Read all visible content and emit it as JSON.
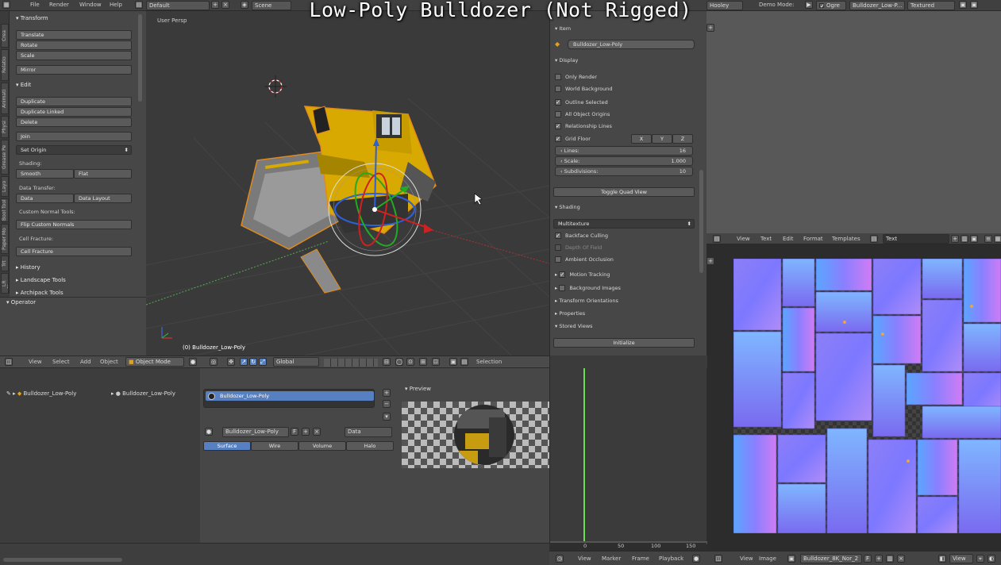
{
  "title_overlay": "Low-Poly Bulldozer (Not Rigged)",
  "topbar": {
    "menus": [
      "File",
      "Render",
      "Window",
      "Help"
    ],
    "layout": "Default",
    "scene": "Scene",
    "scene_name": "Hooley",
    "demo_mode": "Demo Mode:",
    "ogre": "Ogre",
    "object_field": "Bulldozer_Low-P...",
    "shading": "Textured"
  },
  "tabs": [
    "Crea",
    "Relatio",
    "Animati",
    "Physi",
    "Grease Pe",
    "Layo",
    "Bool Tool",
    "Paper Mo",
    "Trt",
    "LR Flare"
  ],
  "toolshelf": {
    "transform_header": "Transform",
    "translate": "Translate",
    "rotate": "Rotate",
    "scale": "Scale",
    "mirror": "Mirror",
    "edit_header": "Edit",
    "duplicate": "Duplicate",
    "duplicate_linked": "Duplicate Linked",
    "delete": "Delete",
    "join": "Join",
    "set_origin": "Set Origin",
    "shading_label": "Shading:",
    "smooth": "Smooth",
    "flat": "Flat",
    "data_transfer_label": "Data Transfer:",
    "data": "Data",
    "data_layout": "Data Layout",
    "custom_normals_label": "Custom Normal Tools:",
    "flip_normals": "Flip Custom Normals",
    "cell_fracture_label": "Cell Fracture:",
    "cell_fracture": "Cell Fracture",
    "history": "History",
    "landscape": "Landscape Tools",
    "archipack": "Archipack Tools",
    "operator": "Operator"
  },
  "viewport": {
    "label": "User Persp",
    "object_label": "(0) Bulldozer_Low-Poly"
  },
  "vp_header": {
    "view": "View",
    "select": "Select",
    "add": "Add",
    "object": "Object",
    "mode": "Object Mode",
    "orientation": "Global",
    "selection": "Selection"
  },
  "props": {
    "item_header": "Item",
    "object_name": "Bulldozer_Low-Poly",
    "display_header": "Display",
    "only_render": "Only Render",
    "world_background": "World Background",
    "outline_selected": "Outline Selected",
    "all_origins": "All Object Origins",
    "relationship_lines": "Relationship Lines",
    "grid_floor": "Grid Floor",
    "axis_x": "X",
    "axis_y": "Y",
    "axis_z": "Z",
    "lines_label": "Lines:",
    "lines_value": "16",
    "scale_label": "Scale:",
    "scale_value": "1.000",
    "subdiv_label": "Subdivisions:",
    "subdiv_value": "10",
    "toggle_quad": "Toggle Quad View",
    "shading_header": "Shading",
    "multitexture": "Multitexture",
    "backface": "Backface Culling",
    "dof": "Depth Of Field",
    "ao": "Ambient Occlusion",
    "motion_tracking": "Motion Tracking",
    "background_images": "Background Images",
    "transform_orient": "Transform Orientations",
    "properties": "Properties",
    "stored_views": "Stored Views",
    "initialize": "Initialize"
  },
  "outliner": {
    "item1": "Bulldozer_Low-Poly",
    "item2": "Bulldozer_Low-Poly"
  },
  "material": {
    "slot": "Bulldozer_Low-Poly",
    "name": "Bulldozer_Low-Poly",
    "f": "F",
    "data": "Data",
    "tabs": [
      "Surface",
      "Wire",
      "Volume",
      "Halo"
    ],
    "preview": "Preview"
  },
  "text_header": {
    "view": "View",
    "text": "Text",
    "edit": "Edit",
    "format": "Format",
    "templates": "Templates",
    "field": "Text"
  },
  "img_header": {
    "view": "View",
    "image": "Image",
    "name": "Bulldozer_8K_Nor_2",
    "f": "F",
    "view2": "View"
  },
  "timeline": {
    "ticks": [
      "0",
      "50",
      "100",
      "150"
    ],
    "view": "View",
    "marker": "Marker",
    "frame": "Frame",
    "playback": "Playback"
  },
  "colors": {
    "accent": "#5680c2",
    "bulldozer": "#e0b400"
  }
}
